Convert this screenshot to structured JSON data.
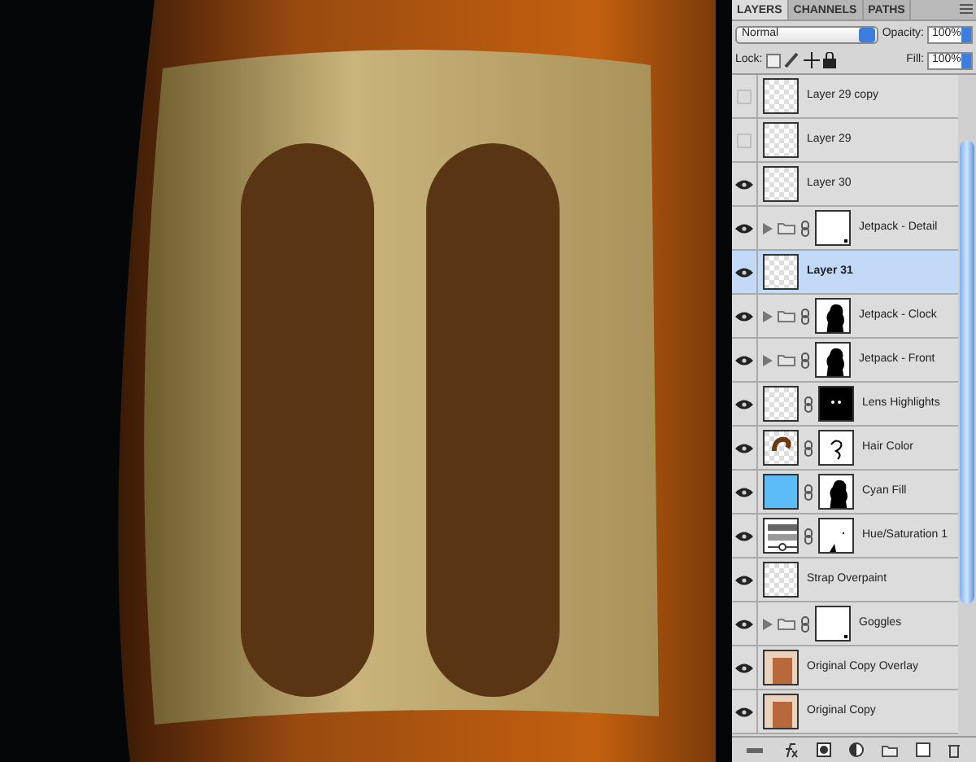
{
  "tabs": [
    {
      "label": "LAYERS",
      "selected": true
    },
    {
      "label": "CHANNELS",
      "selected": false
    },
    {
      "label": "PATHS",
      "selected": false
    }
  ],
  "blend_mode": "Normal",
  "opacity": {
    "label": "Opacity:",
    "value": "100%"
  },
  "lock_label": "Lock:",
  "fill": {
    "label": "Fill:",
    "value": "100%"
  },
  "layers": [
    {
      "name": "Layer 29 copy",
      "visible": false,
      "selected": false,
      "kind": "layer",
      "thumbnail": {
        "kind": "transparent"
      }
    },
    {
      "name": "Layer 29",
      "visible": false,
      "selected": false,
      "kind": "layer",
      "thumbnail": {
        "kind": "transparent"
      }
    },
    {
      "name": "Layer 30",
      "visible": true,
      "selected": false,
      "kind": "layer",
      "thumbnail": {
        "kind": "transparent"
      }
    },
    {
      "name": "Jetpack - Detail",
      "visible": true,
      "selected": false,
      "kind": "group",
      "mask": {
        "kind": "dot"
      }
    },
    {
      "name": "Layer 31",
      "visible": true,
      "selected": true,
      "kind": "layer",
      "thumbnail": {
        "kind": "transparent"
      }
    },
    {
      "name": "Jetpack - Clock",
      "visible": true,
      "selected": false,
      "kind": "group",
      "mask": {
        "kind": "silhouette"
      }
    },
    {
      "name": "Jetpack - Front",
      "visible": true,
      "selected": false,
      "kind": "group",
      "mask": {
        "kind": "silhouette"
      }
    },
    {
      "name": "Lens Highlights",
      "visible": true,
      "selected": false,
      "kind": "masked",
      "thumbnail": {
        "kind": "transparent"
      },
      "mask": {
        "kind": "dots"
      }
    },
    {
      "name": "Hair Color",
      "visible": true,
      "selected": false,
      "kind": "masked",
      "thumbnail": {
        "kind": "hair"
      },
      "mask": {
        "kind": "stroke"
      }
    },
    {
      "name": "Cyan Fill",
      "visible": true,
      "selected": false,
      "kind": "masked",
      "thumbnail": {
        "kind": "cyan"
      },
      "mask": {
        "kind": "silhouette"
      }
    },
    {
      "name": "Hue/Saturation 1",
      "visible": true,
      "selected": false,
      "kind": "masked",
      "thumbnail": {
        "kind": "adjustment"
      },
      "mask": {
        "kind": "speck"
      }
    },
    {
      "name": "Strap Overpaint",
      "visible": true,
      "selected": false,
      "kind": "layer",
      "thumbnail": {
        "kind": "transparent"
      }
    },
    {
      "name": "Goggles",
      "visible": true,
      "selected": false,
      "kind": "group",
      "mask": {
        "kind": "dot"
      }
    },
    {
      "name": "Original Copy Overlay",
      "visible": true,
      "selected": false,
      "kind": "layer",
      "thumbnail": {
        "kind": "photo"
      }
    },
    {
      "name": "Original Copy",
      "visible": true,
      "selected": false,
      "kind": "layer",
      "thumbnail": {
        "kind": "photo"
      }
    }
  ]
}
